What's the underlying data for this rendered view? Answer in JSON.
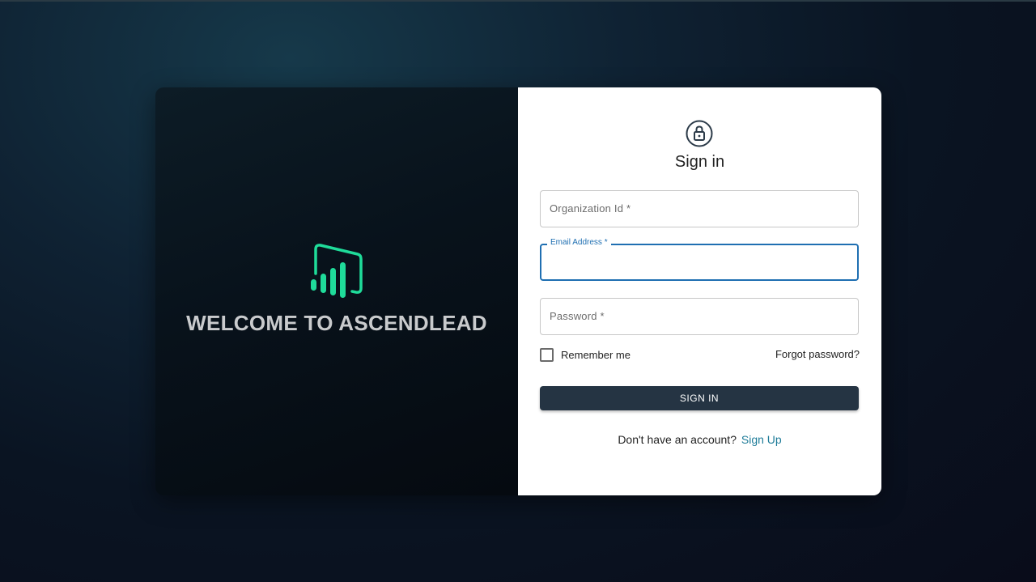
{
  "brand": {
    "welcome_text": "WELCOME TO ASCENDLEAD",
    "logo_icon": "bar-chart-logo-icon",
    "logo_color": "#1fdc9a"
  },
  "signin": {
    "lock_icon": "lock-icon",
    "title": "Sign in",
    "fields": {
      "organization_id": {
        "label": "Organization Id *",
        "value": ""
      },
      "email": {
        "label": "Email Address *",
        "value": ""
      },
      "password": {
        "label": "Password *",
        "value": ""
      }
    },
    "remember_me_label": "Remember me",
    "remember_me_checked": false,
    "forgot_password_label": "Forgot password?",
    "submit_label": "SIGN IN",
    "no_account_text": "Don't have an account?",
    "signup_label": "Sign Up"
  },
  "colors": {
    "accent_blue": "#1f6fb2",
    "button_bg": "#253443",
    "link": "#1f7c99"
  }
}
